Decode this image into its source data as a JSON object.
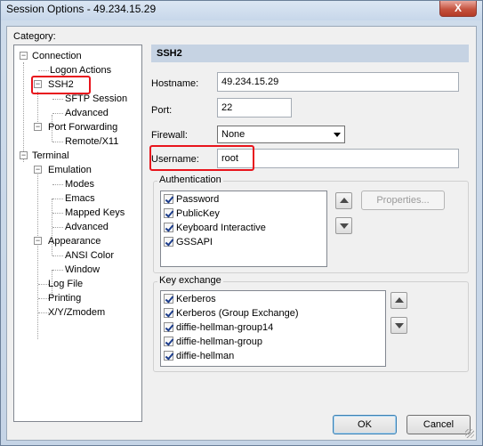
{
  "window": {
    "title": "Session Options - 49.234.15.29",
    "close_symbol": "X"
  },
  "category_label": "Category:",
  "tree": {
    "connection": "Connection",
    "logon_actions": "Logon Actions",
    "ssh2": "SSH2",
    "sftp_session": "SFTP Session",
    "advanced_ssh": "Advanced",
    "port_forwarding": "Port Forwarding",
    "remote_x11": "Remote/X11",
    "terminal": "Terminal",
    "emulation": "Emulation",
    "modes": "Modes",
    "emacs": "Emacs",
    "mapped_keys": "Mapped Keys",
    "advanced_emulation": "Advanced",
    "appearance": "Appearance",
    "ansi_color": "ANSI Color",
    "window_item": "Window",
    "log_file": "Log File",
    "printing": "Printing",
    "xyzmodem": "X/Y/Zmodem"
  },
  "panel": {
    "header": "SSH2",
    "hostname_label": "Hostname:",
    "hostname_value": "49.234.15.29",
    "port_label": "Port:",
    "port_value": "22",
    "firewall_label": "Firewall:",
    "firewall_value": "None",
    "username_label": "Username:",
    "username_value": "root"
  },
  "authentication": {
    "title": "Authentication",
    "items": [
      "Password",
      "PublicKey",
      "Keyboard Interactive",
      "GSSAPI"
    ],
    "properties_label": "Properties..."
  },
  "key_exchange": {
    "title": "Key exchange",
    "items": [
      "Kerberos",
      "Kerberos (Group Exchange)",
      "diffie-hellman-group14",
      "diffie-hellman-group",
      "diffie-hellman"
    ]
  },
  "buttons": {
    "ok": "OK",
    "cancel": "Cancel"
  },
  "colors": {
    "highlight": "#e8141c",
    "header_band": "#c6d3e3"
  }
}
